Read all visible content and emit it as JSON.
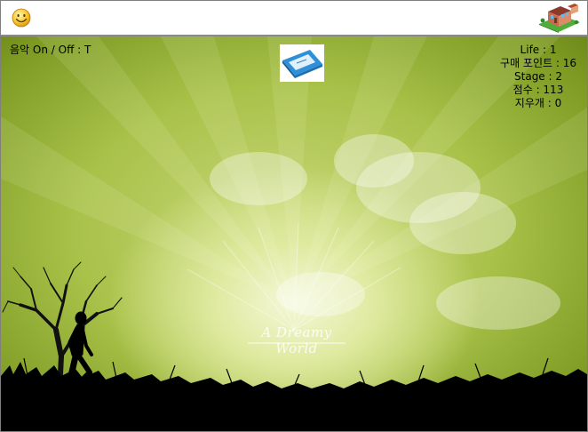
{
  "toolbar": {
    "smiley_icon": "smiley-face-icon",
    "house_icon": "house-icon"
  },
  "hud": {
    "music": "음악 On / Off : T",
    "life": "Life : 1",
    "points": "구매 포인트 : 16",
    "stage": "Stage : 2",
    "score": "점수 : 113",
    "erasers": "지우개 : 0"
  },
  "scene": {
    "watermark": "A Dreamy World",
    "item_icon": "eraser-icon",
    "colors": {
      "sky_light": "#f4f8d8",
      "sky_mid": "#a9c24a",
      "sky_dark": "#5b7614",
      "ground": "#000000",
      "bar_border": "#8a8a8a"
    }
  }
}
